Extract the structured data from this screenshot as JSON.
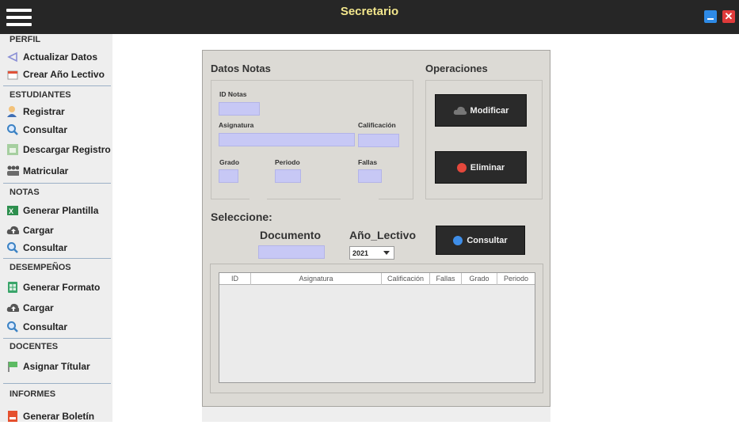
{
  "window": {
    "title": "Secretario"
  },
  "sidebar": {
    "sections": [
      {
        "key": "perfil",
        "label": "PERFIL",
        "items": [
          {
            "key": "actualizar",
            "label": "Actualizar Datos",
            "icon": "edit-profile-icon"
          },
          {
            "key": "crear",
            "label": "Crear Año Lectivo",
            "icon": "calendar-icon"
          }
        ]
      },
      {
        "key": "estudiantes",
        "label": "ESTUDIANTES",
        "items": [
          {
            "key": "registrar",
            "label": "Registrar",
            "icon": "user-add-icon"
          },
          {
            "key": "consultar",
            "label": "Consultar",
            "icon": "search-icon"
          },
          {
            "key": "descargar",
            "label": "Descargar Registro",
            "icon": "download-icon"
          },
          {
            "key": "matricular",
            "label": "Matricular",
            "icon": "group-icon"
          }
        ]
      },
      {
        "key": "notas",
        "label": "NOTAS",
        "items": [
          {
            "key": "plantilla",
            "label": "Generar Plantilla",
            "icon": "excel-icon"
          },
          {
            "key": "cargar",
            "label": "Cargar",
            "icon": "cloud-upload-icon"
          },
          {
            "key": "consultar",
            "label": "Consultar",
            "icon": "search-icon"
          }
        ]
      },
      {
        "key": "desempenos",
        "label": "DESEMPEÑOS",
        "items": [
          {
            "key": "formato",
            "label": "Generar Formato",
            "icon": "sheet-icon"
          },
          {
            "key": "cargar",
            "label": "Cargar",
            "icon": "cloud-upload-icon"
          },
          {
            "key": "consultar",
            "label": "Consultar",
            "icon": "search-icon"
          }
        ]
      },
      {
        "key": "docentes",
        "label": "DOCENTES",
        "items": [
          {
            "key": "titular",
            "label": "Asignar Títular",
            "icon": "flag-icon"
          }
        ]
      },
      {
        "key": "informes",
        "label": "INFORMES",
        "items": [
          {
            "key": "boletin",
            "label": "Generar Boletín",
            "icon": "pdf-icon"
          }
        ]
      }
    ]
  },
  "form": {
    "datos_title": "Datos Notas",
    "operaciones_title": "Operaciones",
    "id_label": "ID Notas",
    "asignatura_label": "Asignatura",
    "calificacion_label": "Calificación",
    "grado_label": "Grado",
    "periodo_label": "Periodo",
    "fallas_label": "Fallas",
    "modificar_label": "Modificar",
    "eliminar_label": "Eliminar"
  },
  "search": {
    "title": "Seleccione:",
    "documento_label": "Documento",
    "anio_label": "Año_Lectivo",
    "anio_value": "2021",
    "consultar_label": "Consultar"
  },
  "table": {
    "columns": [
      "ID",
      "Asignatura",
      "Calificación",
      "Fallas",
      "Grado",
      "Periodo"
    ]
  },
  "colors": {
    "titlebar": "#262626",
    "title_text": "#f2e68c",
    "field_fill": "#c7c8f5",
    "panel": "#dcdad5",
    "button_dark": "#2a2a2a"
  }
}
